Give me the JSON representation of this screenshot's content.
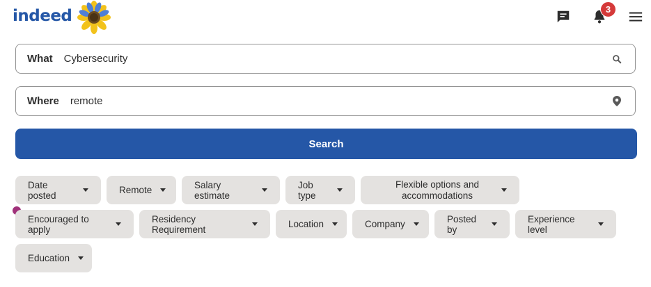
{
  "header": {
    "logo_text": "indeed",
    "messages_icon": "chat-icon",
    "notifications_icon": "bell-icon",
    "notifications_count": "3",
    "menu_icon": "hamburger-icon"
  },
  "search": {
    "what_label": "What",
    "what_value": "Cybersecurity",
    "where_label": "Where",
    "where_value": "remote",
    "button_label": "Search"
  },
  "filters": [
    "Date posted",
    "Remote",
    "Salary estimate",
    "Job type",
    "Flexible options and accommodations",
    "Encouraged to apply",
    "Residency Requirement",
    "Location",
    "Company",
    "Posted by",
    "Experience level",
    "Education"
  ],
  "colors": {
    "brand": "#2557a7",
    "chip_bg": "#e4e2e0",
    "badge": "#d53a3a",
    "indicator_dot": "#a0317a"
  }
}
